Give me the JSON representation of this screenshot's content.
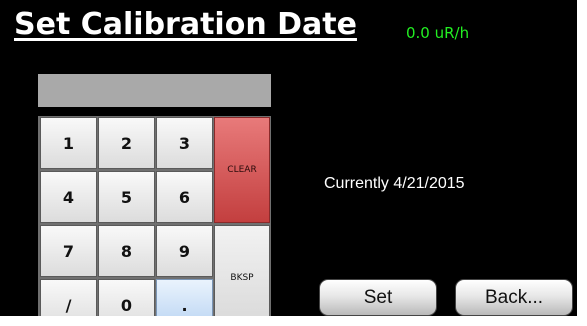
{
  "screen": {
    "title": "Set Calibration Date",
    "dose_rate": "0.0 uR/h",
    "entry_value": "",
    "current_date": "Currently 4/21/2015"
  },
  "keypad": {
    "k1": "1",
    "k2": "2",
    "k3": "3",
    "k4": "4",
    "k5": "5",
    "k6": "6",
    "k7": "7",
    "k8": "8",
    "k9": "9",
    "slash": "/",
    "k0": "0",
    "dot": ".",
    "clear": "CLEAR",
    "bksp": "BKSP"
  },
  "buttons": {
    "set": "Set",
    "back": "Back..."
  },
  "colors": {
    "background": "#000000",
    "dose_rate": "#22ee22",
    "clear_key": "#d05050",
    "dot_key": "#c8def5"
  }
}
